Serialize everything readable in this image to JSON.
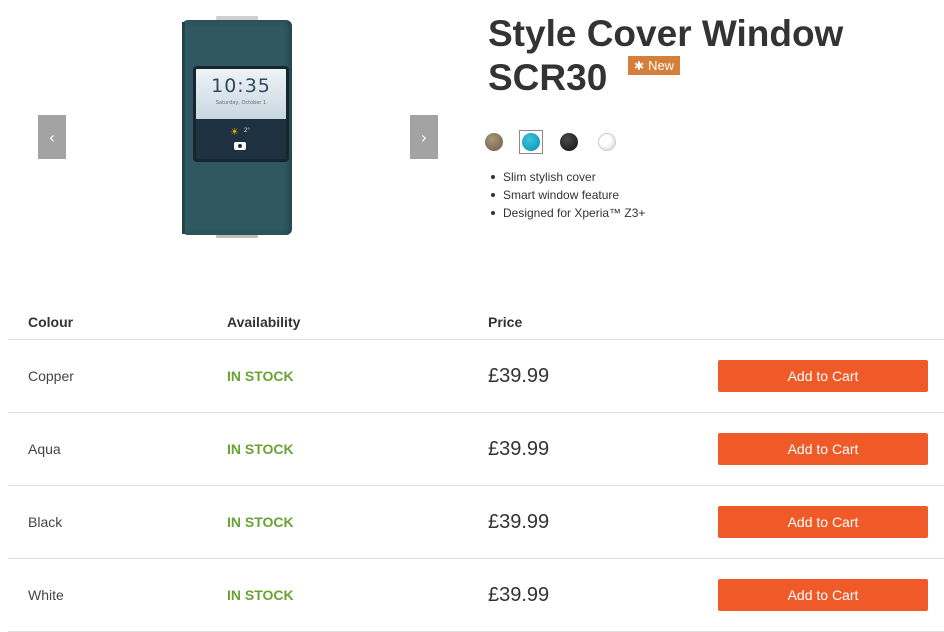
{
  "gallery": {
    "prev_label": "‹",
    "next_label": "›",
    "phone_screen": {
      "clock": "10:35",
      "date": "Saturday, October 1",
      "temp": "2°"
    }
  },
  "product": {
    "title_line1": "Style Cover Window",
    "title_line2": "SCR30",
    "badge_star": "✱",
    "badge_label": "New",
    "colours": [
      {
        "name": "Copper",
        "hex": "#8c7a5f"
      },
      {
        "name": "Aqua",
        "hex": "#0fa6c9"
      },
      {
        "name": "Black",
        "hex": "#262626"
      },
      {
        "name": "White",
        "hex": "#ffffff"
      }
    ],
    "selected_colour": "Aqua",
    "features": [
      "Slim stylish cover",
      "Smart window feature",
      "Designed for Xperia™ Z3+"
    ]
  },
  "table": {
    "headers": {
      "colour": "Colour",
      "availability": "Availability",
      "price": "Price"
    },
    "rows": [
      {
        "colour": "Copper",
        "availability": "IN STOCK",
        "price": "£39.99",
        "button": "Add to Cart"
      },
      {
        "colour": "Aqua",
        "availability": "IN STOCK",
        "price": "£39.99",
        "button": "Add to Cart"
      },
      {
        "colour": "Black",
        "availability": "IN STOCK",
        "price": "£39.99",
        "button": "Add to Cart"
      },
      {
        "colour": "White",
        "availability": "IN STOCK",
        "price": "£39.99",
        "button": "Add to Cart"
      }
    ]
  },
  "colors": {
    "accent": "#f05a28",
    "in_stock": "#6aa333",
    "badge": "#d67f3b",
    "cover": "#2f5861"
  }
}
